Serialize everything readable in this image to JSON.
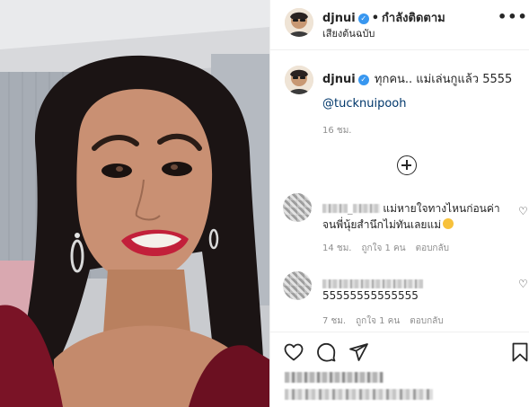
{
  "post": {
    "header": {
      "username": "djnui",
      "separator": "•",
      "follow_status": "กำลังติดตาม",
      "subtitle": "เสียงต้นฉบับ"
    },
    "caption": {
      "username": "djnui",
      "text": "ทุกคน.. แม่เล่นกูแล้ว 5555",
      "mention": "@tucknuipooh",
      "time": "16 ชม."
    },
    "comments": [
      {
        "text_line1": "แม่หายใจทางไหนก่อนค่า",
        "text_line2": "จนพี่นุ้ยสำนึกไม่ทันเลยแม่",
        "time": "14 ชม.",
        "likes": "ถูกใจ 1 คน",
        "reply": "ตอบกลับ"
      },
      {
        "text": "55555555555555",
        "time": "7 ชม.",
        "likes": "ถูกใจ 1 คน",
        "reply": "ตอบกลับ"
      }
    ]
  },
  "icons": {
    "verified": "✓",
    "more": "•••",
    "heart": "♡"
  },
  "colors": {
    "verified_blue": "#3897f0",
    "mention": "#00376b",
    "muted": "#8e8e8e",
    "lipstick": "#c2203a",
    "dress": "#7a1326"
  }
}
